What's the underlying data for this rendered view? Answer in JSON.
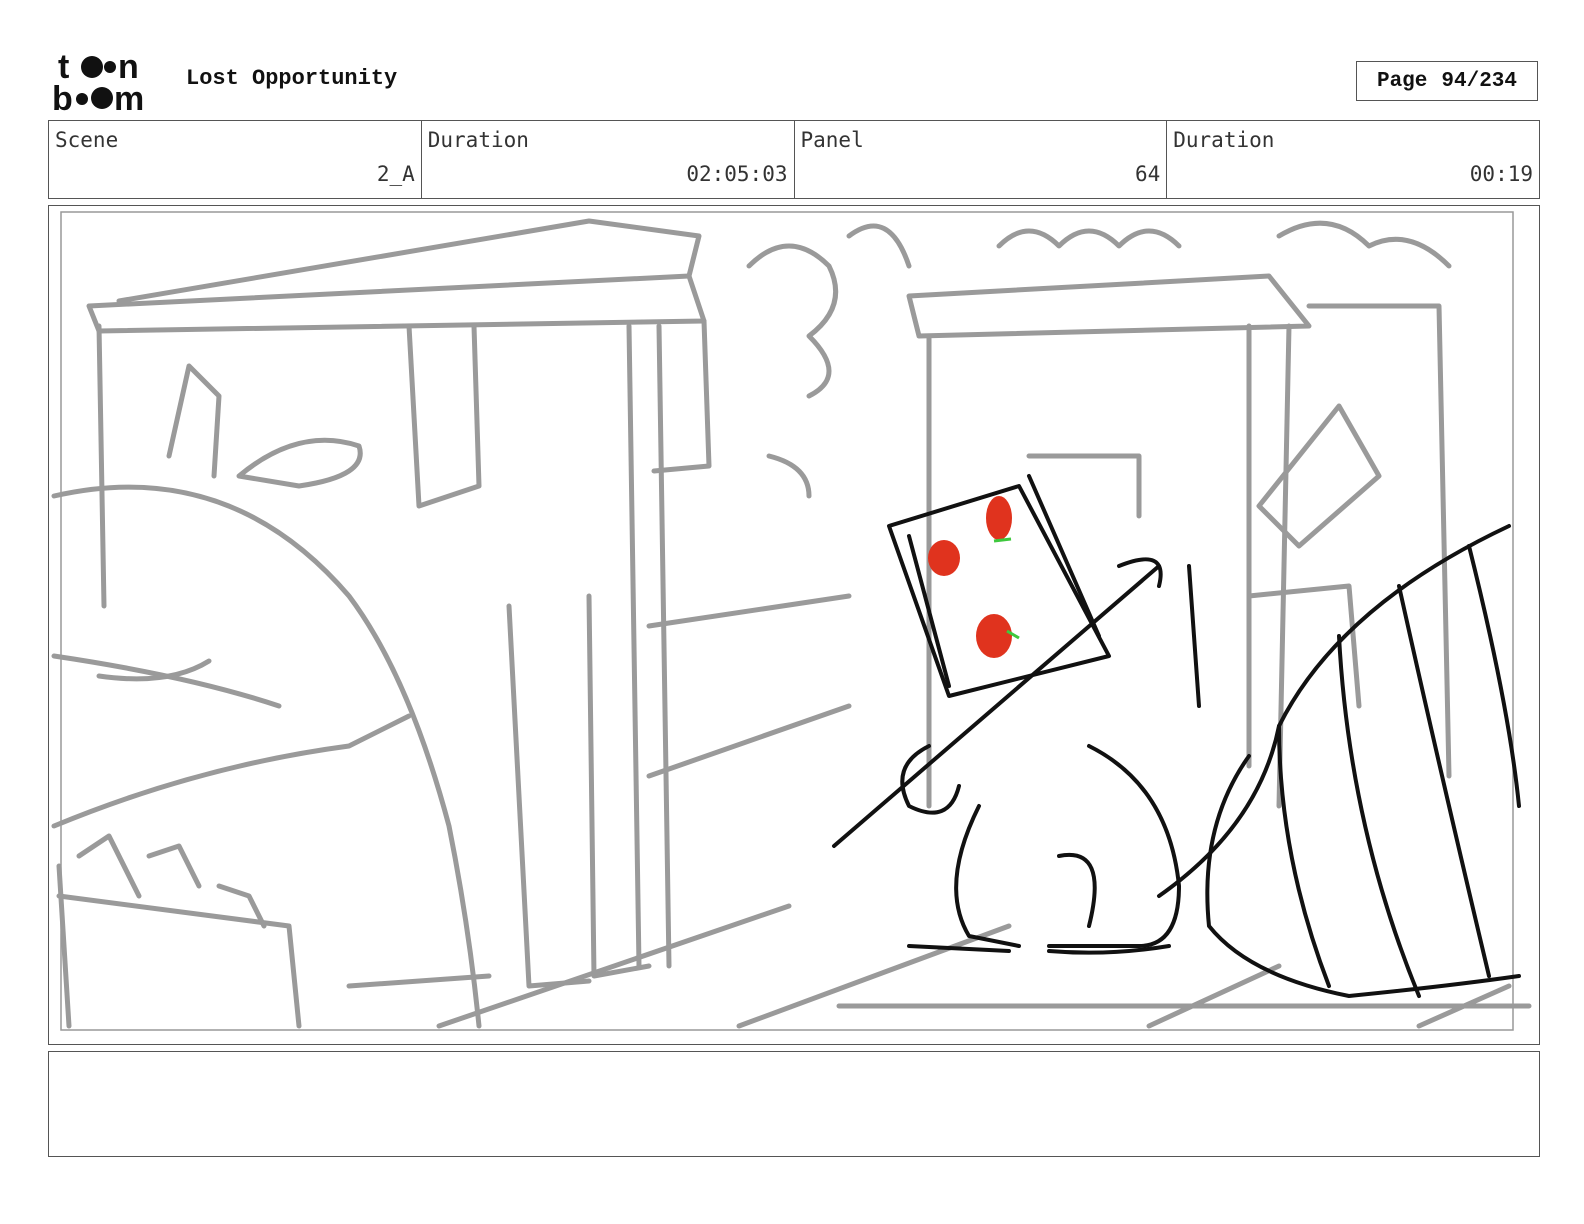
{
  "header": {
    "logo_text": "toon boom",
    "title": "Lost Opportunity",
    "page_label": "Page",
    "page_value": "94/234"
  },
  "info": {
    "scene_label": "Scene",
    "scene_value": "2_A",
    "scene_duration_label": "Duration",
    "scene_duration_value": "02:05:03",
    "panel_label": "Panel",
    "panel_value": "64",
    "panel_duration_label": "Duration",
    "panel_duration_value": "00:19"
  },
  "notes": {
    "text": ""
  }
}
